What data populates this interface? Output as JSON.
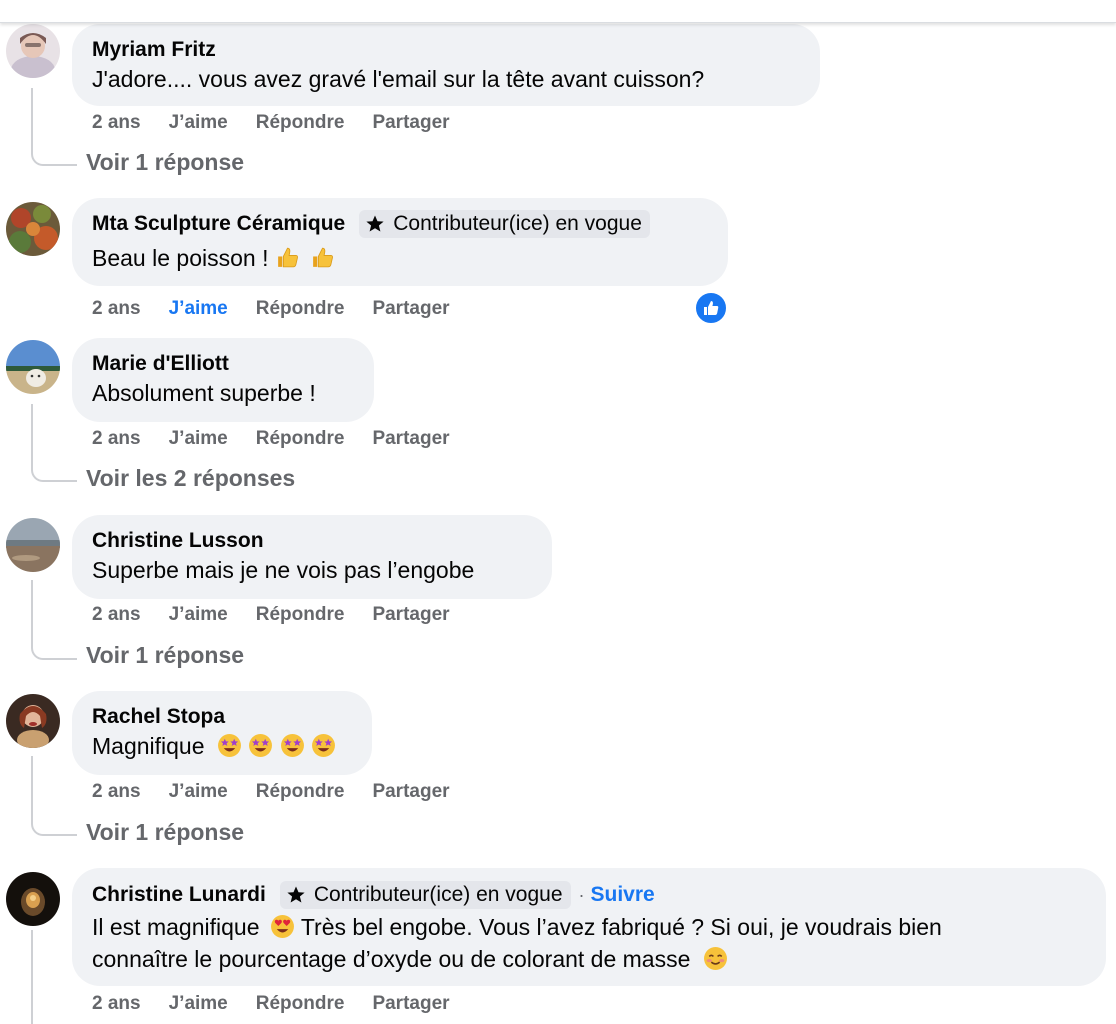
{
  "colors": {
    "bubble": "#f0f2f5",
    "meta_text": "#65676b",
    "accent_blue": "#1877f2",
    "badge_bg": "#e4e6eb"
  },
  "comments": [
    {
      "author": "Myriam Fritz",
      "text": "J'adore.... vous avez gravé l'email sur la tête avant cuisson?",
      "time": "2 ans",
      "like": "J’aime",
      "reply": "Répondre",
      "share": "Partager",
      "see_replies": "Voir 1 réponse"
    },
    {
      "author": "Mta Sculpture Céramique",
      "badge": "Contributeur(ice) en vogue",
      "badge_icon": "star-icon",
      "text": "Beau le poisson !",
      "emojis": [
        "thumbs-up-emoji",
        "thumbs-up-emoji"
      ],
      "time": "2 ans",
      "like": "J’aime",
      "liked": true,
      "reply": "Répondre",
      "share": "Partager",
      "reaction": "like-reaction-icon"
    },
    {
      "author": "Marie d'Elliott",
      "text": "Absolument superbe !",
      "time": "2 ans",
      "like": "J’aime",
      "reply": "Répondre",
      "share": "Partager",
      "see_replies": "Voir les 2 réponses"
    },
    {
      "author": "Christine Lusson",
      "text": "Superbe mais je ne vois pas l’engobe",
      "time": "2 ans",
      "like": "J’aime",
      "reply": "Répondre",
      "share": "Partager",
      "see_replies": "Voir 1 réponse"
    },
    {
      "author": "Rachel Stopa",
      "text": "Magnifique",
      "emojis": [
        "star-struck-emoji",
        "star-struck-emoji",
        "star-struck-emoji",
        "star-struck-emoji"
      ],
      "time": "2 ans",
      "like": "J’aime",
      "reply": "Répondre",
      "share": "Partager",
      "see_replies": "Voir 1 réponse"
    },
    {
      "author": "Christine Lunardi",
      "badge": "Contributeur(ice) en vogue",
      "badge_icon": "star-icon",
      "separator": "·",
      "follow": "Suivre",
      "text_line1_a": "Il est magnifique",
      "text_line1_emoji": "heart-eyes-emoji",
      "text_line1_b": "Très bel engobe. Vous l’avez fabriqué ? Si oui, je voudrais bien",
      "text_line2": "connaître le pourcentage d’oxyde ou de colorant de masse",
      "text_line2_emoji": "smiling-blush-emoji",
      "time": "2 ans",
      "like": "J’aime",
      "reply": "Répondre",
      "share": "Partager"
    }
  ]
}
